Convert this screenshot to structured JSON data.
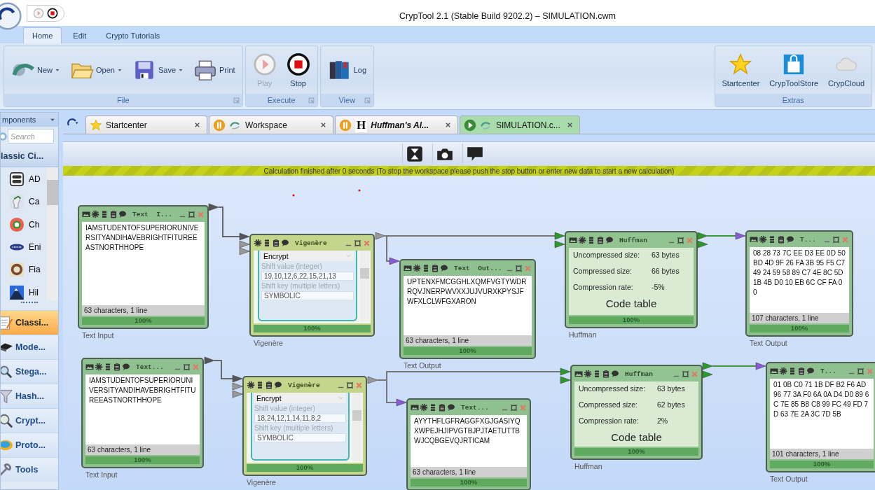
{
  "window": {
    "title": "CrypTool 2.1 (Stable Build 9202.2) – SIMULATION.cwm"
  },
  "ribbon_tabs": [
    {
      "label": "Home",
      "selected": true
    },
    {
      "label": "Edit",
      "selected": false
    },
    {
      "label": "Crypto Tutorials",
      "selected": false
    }
  ],
  "ribbon_groups": [
    {
      "label": "File",
      "launcher": true,
      "buttons": [
        {
          "kind": "new",
          "label": "New",
          "dropdown": true,
          "disabled": false
        },
        {
          "kind": "open",
          "label": "Open",
          "dropdown": true,
          "disabled": false
        },
        {
          "kind": "save",
          "label": "Save",
          "dropdown": true,
          "disabled": false
        },
        {
          "kind": "print",
          "label": "Print",
          "dropdown": false,
          "disabled": false
        }
      ]
    },
    {
      "label": "Execute",
      "launcher": true,
      "buttons": [
        {
          "kind": "play",
          "label": "Play",
          "disabled": true
        },
        {
          "kind": "stop",
          "label": "Stop",
          "disabled": false
        }
      ]
    },
    {
      "label": "View",
      "launcher": true,
      "buttons": [
        {
          "kind": "log",
          "label": "Log",
          "disabled": false
        }
      ]
    },
    {
      "label": "Extras",
      "launcher": false,
      "buttons": [
        {
          "kind": "star",
          "label": "Startcenter",
          "disabled": false
        },
        {
          "kind": "store",
          "label": "CrypToolStore",
          "disabled": false
        },
        {
          "kind": "cloud",
          "label": "CrypCloud",
          "disabled": false
        }
      ]
    }
  ],
  "sidebar": {
    "header": "mponents",
    "search": {
      "placeholder": "Search"
    },
    "group": "lassic Ci...",
    "items": [
      {
        "kind": "adfgvx",
        "label": "AD"
      },
      {
        "kind": "caesar",
        "label": "Ca"
      },
      {
        "kind": "ring",
        "label": "Ch"
      },
      {
        "kind": "enigma",
        "label": "Eni"
      },
      {
        "kind": "seal",
        "label": "Fia"
      },
      {
        "kind": "mountain",
        "label": "Hil"
      }
    ],
    "categories": [
      {
        "kind": "classic",
        "label": "Classi...",
        "selected": true
      },
      {
        "kind": "modern",
        "label": "Mode...",
        "selected": false
      },
      {
        "kind": "stega",
        "label": "Stega...",
        "selected": false
      },
      {
        "kind": "hash",
        "label": "Hash...",
        "selected": false
      },
      {
        "kind": "crypt",
        "label": "Crypt...",
        "selected": false
      },
      {
        "kind": "proto",
        "label": "Proto...",
        "selected": false
      },
      {
        "kind": "tools",
        "label": "Tools",
        "selected": false
      }
    ]
  },
  "doc_tabs": [
    {
      "kind": "startcenter",
      "label": "Startcenter",
      "selected": false,
      "paused": false,
      "running": false
    },
    {
      "kind": "workspace",
      "label": "Workspace",
      "selected": false,
      "paused": true,
      "running": false
    },
    {
      "kind": "document",
      "label": "Huffman's Al...",
      "selected": false,
      "paused": true,
      "running": false,
      "badge": "H"
    },
    {
      "kind": "workspace",
      "label": "SIMULATION.c...",
      "selected": true,
      "paused": false,
      "running": true
    }
  ],
  "status": "Calculation finished after 0 seconds (To stop the workspace please push the stop button or enter new data to start a new calculation)",
  "nodes": [
    {
      "kind": "text",
      "title": "Text  I...",
      "content": "IAMSTUDENTOFSUPERIORUNIVERSITYANDIHAVEBRIGHTFITUREEASTNORTHHOPE",
      "status": "63 characters,  1 line",
      "level": 1,
      "progress": "100%",
      "label": "Text Input"
    },
    {
      "kind": "vigenere",
      "title": "Vigenère",
      "mode": "Encrypt",
      "fields": [
        {
          "label": "Shift value (integer)",
          "value": "19,10,12,6,22,15,21,13"
        },
        {
          "label": "Shift key (multiple letters)",
          "value": "SYMBOLIC"
        }
      ],
      "level": 1,
      "progress": "100%",
      "label": "Vigenère"
    },
    {
      "kind": "text",
      "title": "Text  Out...",
      "content": "UPTENXFMCGGHLXQMFVGTYWDRRQVJNERPWVXXJUJVURXKPYSJFWFXLCLWFGXARON",
      "status": "63 characters,  1 line",
      "level": 1,
      "progress": "100%",
      "label": "Text Output"
    },
    {
      "kind": "huffman",
      "title": "Huffman",
      "stats": [
        {
          "label": "Uncompressed size:",
          "value": "63 bytes"
        },
        {
          "label": "Compressed size:",
          "value": "66 bytes"
        },
        {
          "label": "Compression rate:",
          "value": "-5%"
        }
      ],
      "link": "Code table",
      "level": 1,
      "progress": "100%",
      "label": "Huffman"
    },
    {
      "kind": "text",
      "title": "T...",
      "content": "08 28 73 7C EE D3 EE 0D 50 BD 4D 9F 26 FA 3B 95 F5 C7 49 24 59 58 89 C7 4E 8C 5D 1B 4B D0 10 EB 6C CF FA 00",
      "status": "107 characters,  1 line",
      "level": 1,
      "progress": "100%",
      "label": "Text Output"
    },
    {
      "kind": "text",
      "title": "Text...",
      "content": "IAMSTUDENTOFSUPERIORUNIVERSITYANDIHAVEBRIGHTFITUREEASTNORTHHOPE",
      "status": "63 characters,  1 line",
      "level": 1,
      "progress": "100%",
      "label": "Text Input"
    },
    {
      "kind": "vigenere",
      "title": "Vigenère",
      "mode": "Encrypt",
      "fields": [
        {
          "label": "Shift value (integer)",
          "value": "18,24,12,1,14,11,8,2"
        },
        {
          "label": "Shift key (multiple letters)",
          "value": "SYMBOLIC"
        }
      ],
      "level": 1,
      "progress": "100%",
      "label": "Vigenère"
    },
    {
      "kind": "text",
      "title": "Text...",
      "content": "AYYTHFLGFRAGGFXGJGASIYQXWPEJHJIPVGTBJPJTAETUTTBWJCQBGEVQJRTICAM",
      "status": "63 characters,  1 line",
      "level": 1,
      "progress": "100%"
    },
    {
      "kind": "huffman",
      "title": "Huffman",
      "stats": [
        {
          "label": "Uncompressed size:",
          "value": "63 bytes"
        },
        {
          "label": "Compressed size:",
          "value": "62 bytes"
        },
        {
          "label": "Compression rate:",
          "value": "2%"
        }
      ],
      "link": "Code table",
      "level": 1,
      "progress": "100%",
      "label": "Huffman"
    },
    {
      "kind": "text",
      "title": "T...",
      "content": "01 0B C0 71 1B DF B2 F6 AD 96 77 3A F0 6A 0A D4 D0 89 6C 7E 85 B8 C8 99 FC 49 FD 7D 63 7E 2A 3C 7D 5B",
      "status": "101 characters,  1 line",
      "level": 1,
      "progress": "100%",
      "label": "Text Output"
    }
  ]
}
